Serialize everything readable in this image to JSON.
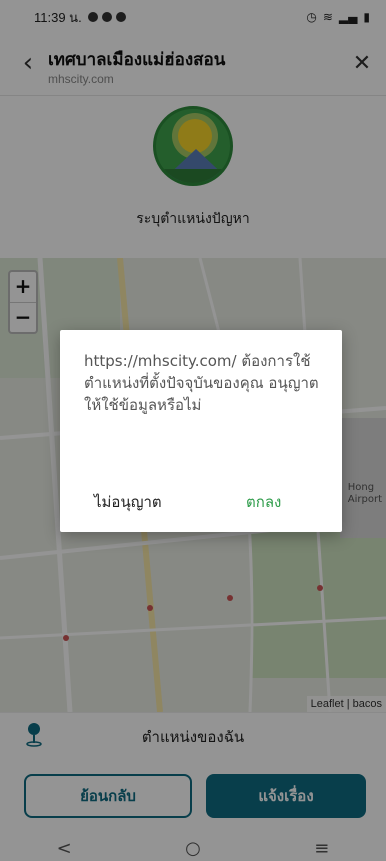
{
  "status_bar": {
    "time": "11:39 น."
  },
  "header": {
    "title": "เทศบาลเมืองแม่ฮ่องสอน",
    "url": "mhscity.com"
  },
  "content": {
    "location_prompt": "ระบุตำแหน่งปัญหา"
  },
  "map": {
    "zoom_in": "+",
    "zoom_out": "−",
    "attribution": "Leaflet | bacos",
    "place_labels": [
      "Hong",
      "Airport"
    ]
  },
  "my_location": {
    "label": "ตำแหน่งของฉัน"
  },
  "actions": {
    "back_label": "ย้อนกลับ",
    "report_label": "แจ้งเรื่อง"
  },
  "nav": {
    "back": "<",
    "home": "○",
    "recents": "≡"
  },
  "dialog": {
    "message": "https://mhscity.com/ ต้องการใช้ตำแหน่งที่ตั้งปัจจุบันของคุณ อนุญาตให้ใช้ข้อมูลหรือไม่",
    "deny_label": "ไม่อนุญาต",
    "allow_label": "ตกลง"
  },
  "colors": {
    "primary": "#0e6b82",
    "allow_green": "#2e9c4a"
  }
}
